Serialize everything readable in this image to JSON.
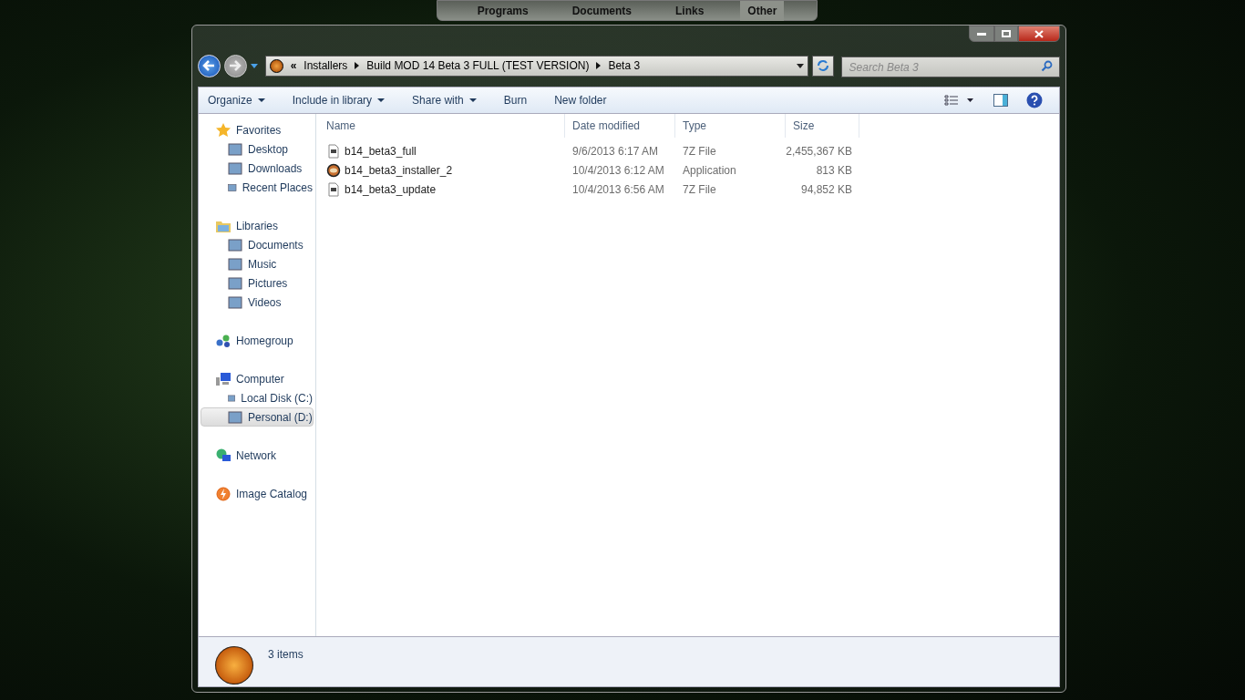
{
  "dock": {
    "items": [
      {
        "label": "Programs"
      },
      {
        "label": "Documents"
      },
      {
        "label": "Links"
      },
      {
        "label": "Other",
        "selected": true
      }
    ]
  },
  "address_bar": {
    "overflow": "«",
    "crumbs": [
      "Installers",
      "Build MOD 14 Beta 3 FULL (TEST VERSION)",
      "Beta 3"
    ]
  },
  "search": {
    "placeholder": "Search Beta 3"
  },
  "toolbar": {
    "buttons": [
      {
        "label": "Organize",
        "dropdown": true
      },
      {
        "label": "Include in library",
        "dropdown": true
      },
      {
        "label": "Share with",
        "dropdown": true
      },
      {
        "label": "Burn",
        "dropdown": false
      },
      {
        "label": "New folder",
        "dropdown": false
      }
    ]
  },
  "sidebar": {
    "groups": [
      {
        "label": "Favorites",
        "children": [
          {
            "label": "Desktop",
            "selected": false
          },
          {
            "label": "Downloads",
            "selected": false
          },
          {
            "label": "Recent Places",
            "selected": false
          }
        ]
      },
      {
        "label": "Libraries",
        "children": [
          {
            "label": "Documents",
            "selected": false
          },
          {
            "label": "Music",
            "selected": false
          },
          {
            "label": "Pictures",
            "selected": false
          },
          {
            "label": "Videos",
            "selected": false
          }
        ]
      },
      {
        "label": "Homegroup"
      },
      {
        "label": "Computer",
        "children": [
          {
            "label": "Local Disk (C:)",
            "selected": false
          },
          {
            "label": "Personal (D:)",
            "selected": true
          }
        ]
      },
      {
        "label": "Network"
      },
      {
        "label": "Image Catalog"
      }
    ]
  },
  "table": {
    "columns": [
      "Name",
      "Date modified",
      "Type",
      "Size"
    ],
    "rows": [
      {
        "kind": "archive",
        "cells": [
          "b14_beta3_full",
          "9/6/2013 6:17 AM",
          "7Z File",
          "2,455,367 KB"
        ]
      },
      {
        "kind": "app",
        "cells": [
          "b14_beta3_installer_2",
          "10/4/2013 6:12 AM",
          "Application",
          "813 KB"
        ]
      },
      {
        "kind": "archive",
        "cells": [
          "b14_beta3_update",
          "10/4/2013 6:56 AM",
          "7Z File",
          "94,852 KB"
        ]
      }
    ]
  },
  "status_bar": {
    "text": "3 items"
  }
}
